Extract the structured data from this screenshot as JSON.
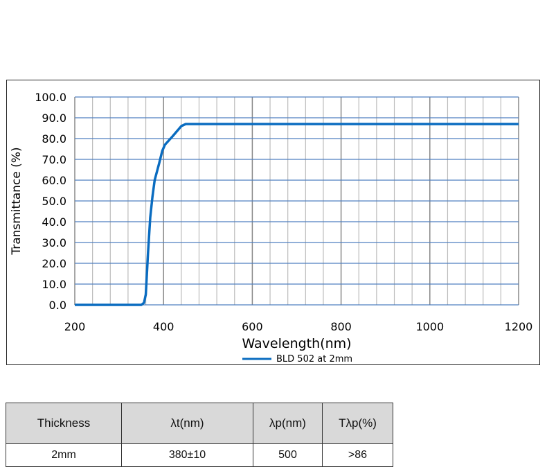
{
  "chart_data": {
    "type": "line",
    "xlabel": "Wavelength(nm)",
    "ylabel": "Transmittance (%)",
    "xlim": [
      200,
      1200
    ],
    "ylim": [
      0,
      100
    ],
    "xticks": [
      200,
      400,
      600,
      800,
      1000,
      1200
    ],
    "yticks": [
      "0.0",
      "10.0",
      "20.0",
      "30.0",
      "40.0",
      "50.0",
      "60.0",
      "70.0",
      "80.0",
      "90.0",
      "100.0"
    ],
    "grid": true,
    "legend": "bottom-center",
    "series": [
      {
        "name": "BLD 502 at 2mm",
        "color": "#0a6cc0",
        "x": [
          200,
          350,
          356,
          360,
          365,
          370,
          375,
          380,
          390,
          397,
          403,
          420,
          440,
          450,
          1200
        ],
        "y": [
          0,
          0,
          1,
          5,
          25,
          42,
          52,
          60,
          68,
          74,
          77,
          81,
          86,
          87,
          87
        ]
      }
    ]
  },
  "table": {
    "headers": [
      "Thickness",
      "λt(nm)",
      "λp(nm)",
      "Tλp(%)"
    ],
    "rows": [
      [
        "2mm",
        "380±10",
        "500",
        ">86"
      ]
    ]
  }
}
